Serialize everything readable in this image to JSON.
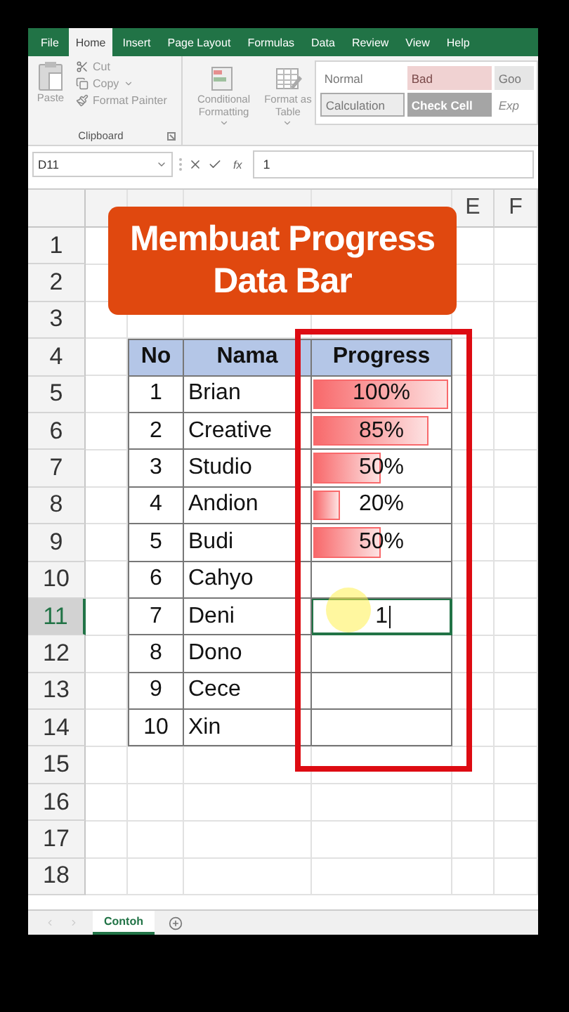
{
  "tabs": [
    {
      "label": "File",
      "selected": false
    },
    {
      "label": "Home",
      "selected": true
    },
    {
      "label": "Insert",
      "selected": false
    },
    {
      "label": "Page Layout",
      "selected": false
    },
    {
      "label": "Formulas",
      "selected": false
    },
    {
      "label": "Data",
      "selected": false
    },
    {
      "label": "Review",
      "selected": false
    },
    {
      "label": "View",
      "selected": false
    },
    {
      "label": "Help",
      "selected": false
    }
  ],
  "clipboard": {
    "paste": "Paste",
    "cut": "Cut",
    "copy": "Copy",
    "format_painter": "Format Painter",
    "group_label": "Clipboard"
  },
  "styles": {
    "conditional": "Conditional Formatting",
    "format_table": "Format as Table",
    "gallery": [
      {
        "label": "Normal",
        "kind": "normal"
      },
      {
        "label": "Bad",
        "kind": "bad"
      },
      {
        "label": "Goo",
        "kind": "good"
      },
      {
        "label": "Calculation",
        "kind": "calculation"
      },
      {
        "label": "Check Cell",
        "kind": "check"
      },
      {
        "label": "Exp",
        "kind": "explanatory"
      }
    ]
  },
  "formula_bar": {
    "name_box": "D11",
    "function_label": "fx",
    "value": "1"
  },
  "sheet": {
    "columns": [
      {
        "label": "E",
        "selected": false
      },
      {
        "label": "F",
        "selected": false
      }
    ],
    "banner": {
      "lines": [
        "Membuat Progress",
        "Data Bar"
      ]
    },
    "rows": [
      {
        "label": "1",
        "selected": false
      },
      {
        "label": "2",
        "selected": false
      },
      {
        "label": "3",
        "selected": false
      },
      {
        "label": "4",
        "selected": false,
        "kind": "header",
        "no": "No",
        "nama": "Nama",
        "progress": "Progress"
      },
      {
        "label": "5",
        "selected": false,
        "kind": "data",
        "no": "1",
        "nama": "Brian",
        "progress": {
          "kind": "bar",
          "text": "100%",
          "level": 1.0
        }
      },
      {
        "label": "6",
        "selected": false,
        "kind": "data",
        "no": "2",
        "nama": "Creative",
        "progress": {
          "kind": "bar",
          "text": "85%",
          "level": 0.85
        }
      },
      {
        "label": "7",
        "selected": false,
        "kind": "data",
        "no": "3",
        "nama": "Studio",
        "progress": {
          "kind": "bar",
          "text": "50%",
          "level": 0.5
        }
      },
      {
        "label": "8",
        "selected": false,
        "kind": "data",
        "no": "4",
        "nama": "Andion",
        "progress": {
          "kind": "bar",
          "text": "20%",
          "level": 0.2
        }
      },
      {
        "label": "9",
        "selected": false,
        "kind": "data",
        "no": "5",
        "nama": "Budi",
        "progress": {
          "kind": "bar",
          "text": "50%",
          "level": 0.5
        }
      },
      {
        "label": "10",
        "selected": false,
        "kind": "data",
        "no": "6",
        "nama": "Cahyo"
      },
      {
        "label": "11",
        "selected": true,
        "kind": "data",
        "no": "7",
        "nama": "Deni",
        "progress": {
          "kind": "editing",
          "value": "1"
        }
      },
      {
        "label": "12",
        "selected": false,
        "kind": "data",
        "no": "8",
        "nama": "Dono"
      },
      {
        "label": "13",
        "selected": false,
        "kind": "data",
        "no": "9",
        "nama": "Cece"
      },
      {
        "label": "14",
        "selected": false,
        "kind": "data",
        "no": "10",
        "nama": "Xin"
      },
      {
        "label": "15",
        "selected": false
      },
      {
        "label": "16",
        "selected": false
      },
      {
        "label": "17",
        "selected": false
      },
      {
        "label": "18",
        "selected": false
      }
    ]
  },
  "sheet_tabs": [
    {
      "label": "Contoh",
      "selected": true
    }
  ]
}
